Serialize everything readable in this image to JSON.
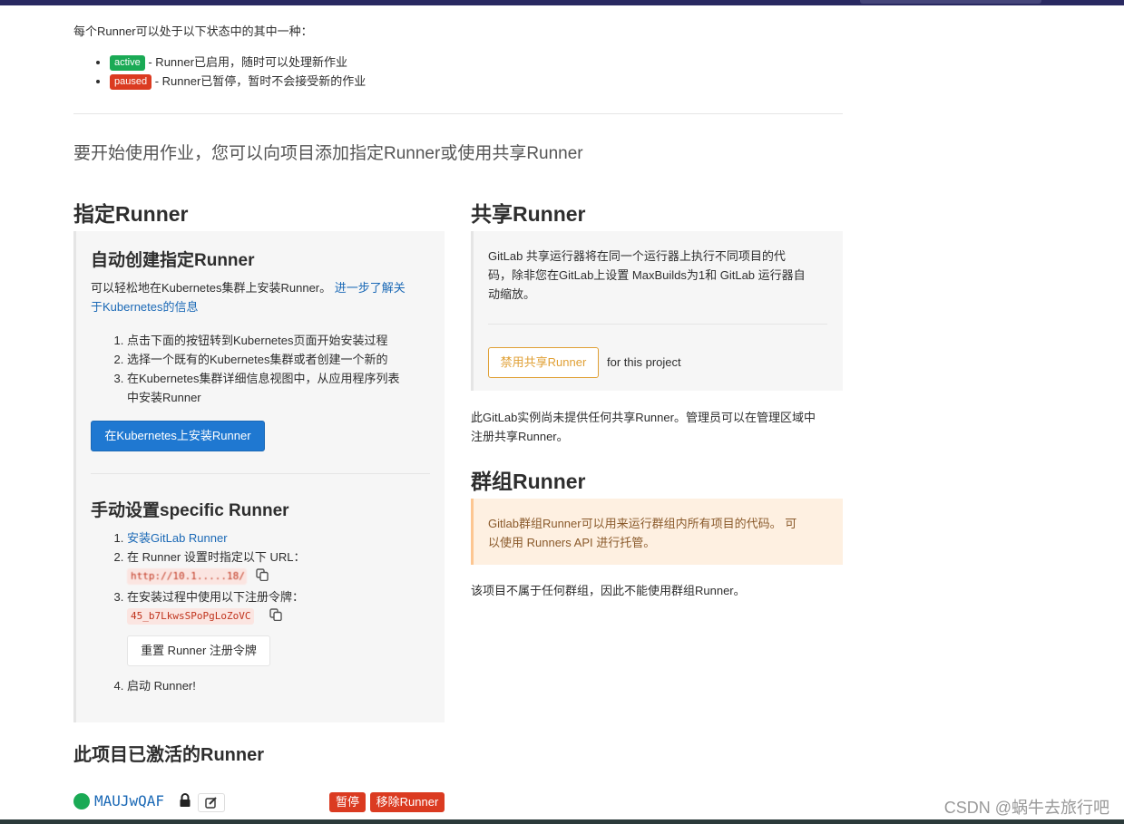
{
  "status_section": {
    "intro": "每个Runner可以处于以下状态中的其中一种：",
    "items": [
      {
        "badge": "active",
        "text": " - Runner已启用，随时可以处理新作业"
      },
      {
        "badge": "paused",
        "text": " - Runner已暂停，暂时不会接受新的作业"
      }
    ]
  },
  "lead": "要开始使用作业，您可以向项目添加指定Runner或使用共享Runner",
  "specific": {
    "title": "指定Runner",
    "auto": {
      "title": "自动创建指定Runner",
      "desc": "可以轻松地在Kubernetes集群上安装Runner。",
      "link_line1": "进一步了解关",
      "link_line2": "于Kubernetes的信息",
      "steps": [
        "点击下面的按钮转到Kubernetes页面开始安装过程",
        "选择一个既有的Kubernetes集群或者创建一个新的",
        "在Kubernetes集群详细信息视图中，从应用程序列表",
        "中安装Runner"
      ],
      "install_button": "在Kubernetes上安装Runner"
    },
    "manual": {
      "title": "手动设置specific Runner",
      "step1_link": "安装GitLab Runner",
      "step2": "在 Runner 设置时指定以下 URL：",
      "url_value": "http://10.1.....18/",
      "step3": "在安装过程中使用以下注册令牌：",
      "token_value": "45_b7LkwsSPoPgLoZoVC",
      "reset_button": "重置 Runner 注册令牌",
      "step4": "启动 Runner!"
    }
  },
  "shared": {
    "title": "共享Runner",
    "desc_line1": "GitLab 共享运行器将在同一个运行器上执行不同项目的代",
    "desc_line2": "码，除非您在GitLab上设置 MaxBuilds为1和 GitLab 运行器自",
    "desc_line3": "动缩放。",
    "disable_button": "禁用共享Runner",
    "for_project": "for this project",
    "none_line1": "此GitLab实例尚未提供任何共享Runner。管理员可以在管理区域中",
    "none_line2": "注册共享Runner。"
  },
  "group": {
    "title": "群组Runner",
    "desc_line1": "Gitlab群组Runner可以用来运行群组内所有项目的代码。 可",
    "desc_line2": "以使用 Runners API 进行托管。",
    "note": "该项目不属于任何群组，因此不能使用群组Runner。"
  },
  "active_runners": {
    "title": "此项目已激活的Runner",
    "runner_id": "MAUJwQAF",
    "pause_button": "暂停",
    "remove_button": "移除Runner"
  },
  "watermark": "CSDN @蜗牛去旅行吧",
  "colors": {
    "topbar": "#292961",
    "primary": "#1f78d1",
    "success": "#1aaa55",
    "danger": "#db3b21",
    "link": "#1b69b6",
    "warning_bg": "#fef0e1"
  },
  "icons": [
    "copy-icon",
    "lock-icon",
    "edit-icon"
  ]
}
